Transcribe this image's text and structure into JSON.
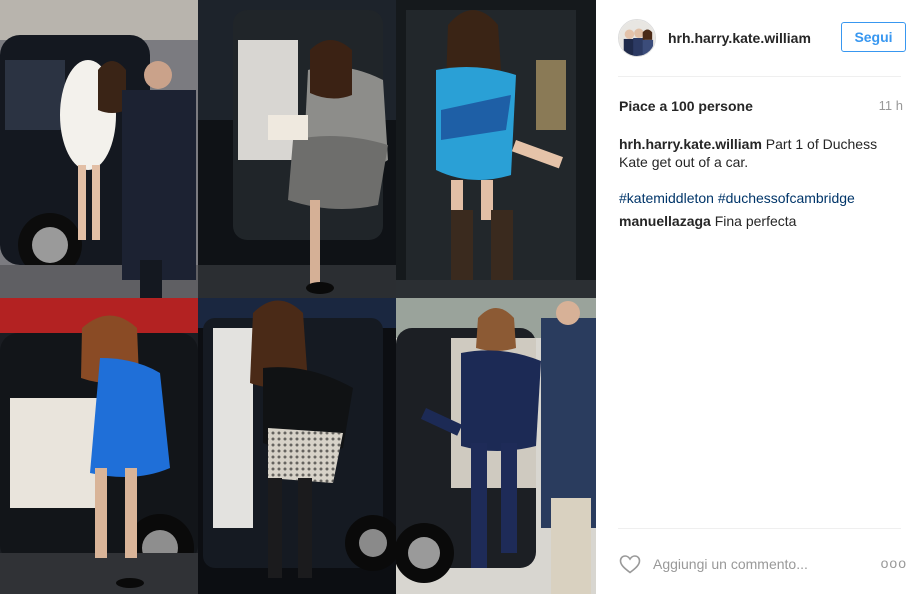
{
  "post": {
    "username": "hrh.harry.kate.william",
    "follow_label": "Segui",
    "likes_text": "Piace a 100 persone",
    "time_ago": "11 h",
    "caption_user": "hrh.harry.kate.william",
    "caption_text": " Part 1 of Duchess Kate get out of a car.",
    "hashtags": [
      "#katemiddleton",
      "#duchessofcambridge"
    ],
    "comment_user": "manuellazaga",
    "comment_text": " Fina perfecta",
    "add_comment_placeholder": "Aggiungi un commento...",
    "more_glyph": "ooo"
  },
  "colors": {
    "accent_blue": "#3897f0",
    "hashtag_blue": "#003569",
    "text_dark": "#262626",
    "muted_gray": "#999999"
  },
  "icons": {
    "avatar": "profile-photo",
    "like": "heart-outline-icon",
    "more": "more-options-icon"
  },
  "collage": {
    "tiles": [
      "photo-white-coat-exit",
      "photo-grey-dress-exit",
      "photo-blue-top-exit",
      "photo-blue-dress-exit",
      "photo-black-lace-skirt-exit",
      "photo-navy-tracksuit-exit"
    ]
  }
}
